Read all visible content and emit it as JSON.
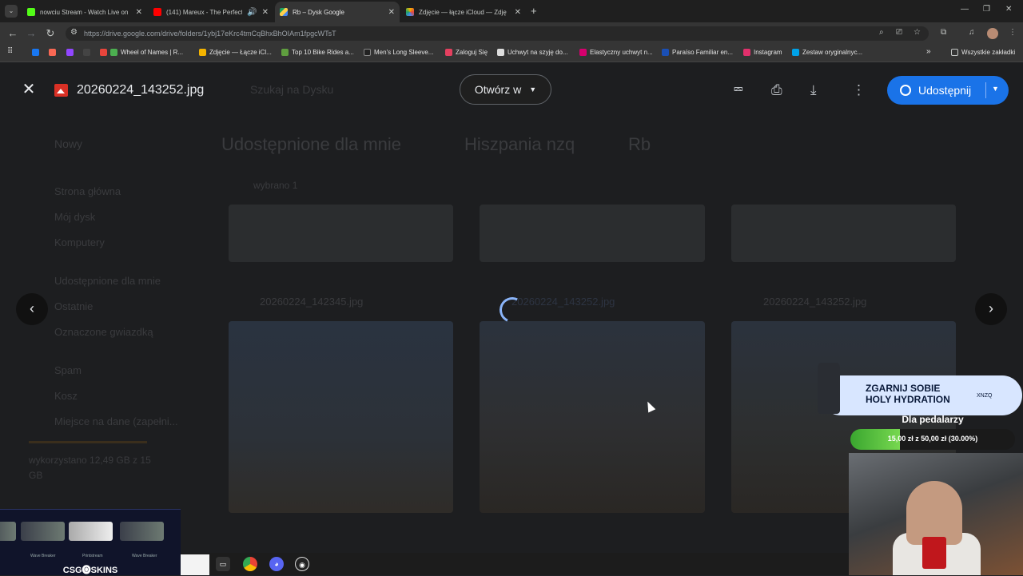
{
  "browser": {
    "tabs": [
      {
        "title": "nowciu Stream - Watch Live on",
        "favicon_color": "#53fc18",
        "active": false
      },
      {
        "title": "(141) Mareux - The Perfect",
        "favicon_color": "#ff0000",
        "active": false
      },
      {
        "title": "Rb – Dysk Google",
        "favicon_color": "#1fa463",
        "active": true
      },
      {
        "title": "Zdjęcie — łącze iCloud — Zdję",
        "favicon_color": "#f4b400",
        "active": false
      }
    ],
    "url": "https://drive.google.com/drive/folders/1ybj17eKrc4tmCqBhxBhOIAm1fpgcWTsT",
    "bookmarks": [
      {
        "label": "",
        "color": "#1877f2"
      },
      {
        "label": "",
        "color": "#f96854"
      },
      {
        "label": "",
        "color": "#9146ff"
      },
      {
        "label": "",
        "color": "#444"
      },
      {
        "label": "Wheel of Names | R...",
        "color": "#e8453c"
      },
      {
        "label": "Zdjęcie — Łącze iCl...",
        "color": "#f4b400"
      },
      {
        "label": "Top 10 Bike Rides a...",
        "color": "#5f9e3f"
      },
      {
        "label": "Men's Long Sleeve...",
        "color": "#222"
      },
      {
        "label": "Zaloguj Się",
        "color": "#e4405f"
      },
      {
        "label": "Uchwyt na szyję do...",
        "color": "#ddd"
      },
      {
        "label": "Elastyczny uchwyt n...",
        "color": "#d6006e"
      },
      {
        "label": "Paraíso Familiar en...",
        "color": "#1a4fb5"
      },
      {
        "label": "Instagram",
        "color": "#e1306c"
      },
      {
        "label": "Zestaw oryginalnyc...",
        "color": "#00a2e8"
      }
    ],
    "all_bookmarks_label": "Wszystkie zakładki"
  },
  "viewer": {
    "filename": "20260224_143252.jpg",
    "open_with_label": "Otwórz w",
    "share_label": "Udostępnij"
  },
  "drive_bg": {
    "search_placeholder": "Szukaj na Dysku",
    "new_label": "Nowy",
    "breadcrumb": [
      "Udostępnione dla mnie",
      "Hiszpania nzq",
      "Rb"
    ],
    "selected_label": "wybrano 1",
    "sidebar": [
      "Strona główna",
      "Mój dysk",
      "Komputery",
      "Udostępnione dla mnie",
      "Ostatnie",
      "Oznaczone gwiazdką",
      "Spam",
      "Kosz",
      "Miejsce na dane (zapełni..."
    ],
    "storage_text": "wykorzystano 12,49 GB z 15 GB",
    "files": [
      "20260224_142345.jpg",
      "20260224_143252.jpg",
      "20260224_143252.jpg"
    ]
  },
  "overlay": {
    "csgo_label": "CSG🅞SKINS",
    "guns": [
      "Wave Breaker",
      "Printstream",
      "Wave Breaker"
    ],
    "promo_title_line1": "ZGARNIJ SOBIE",
    "promo_title_line2": "HOLY HYDRATION",
    "promo_code": "XNZQ",
    "goal_title": "Dla pedalarzy",
    "goal_text": "15,00 zł z 50,00 zł (30.00%)",
    "goal_fraction": 0.3
  }
}
